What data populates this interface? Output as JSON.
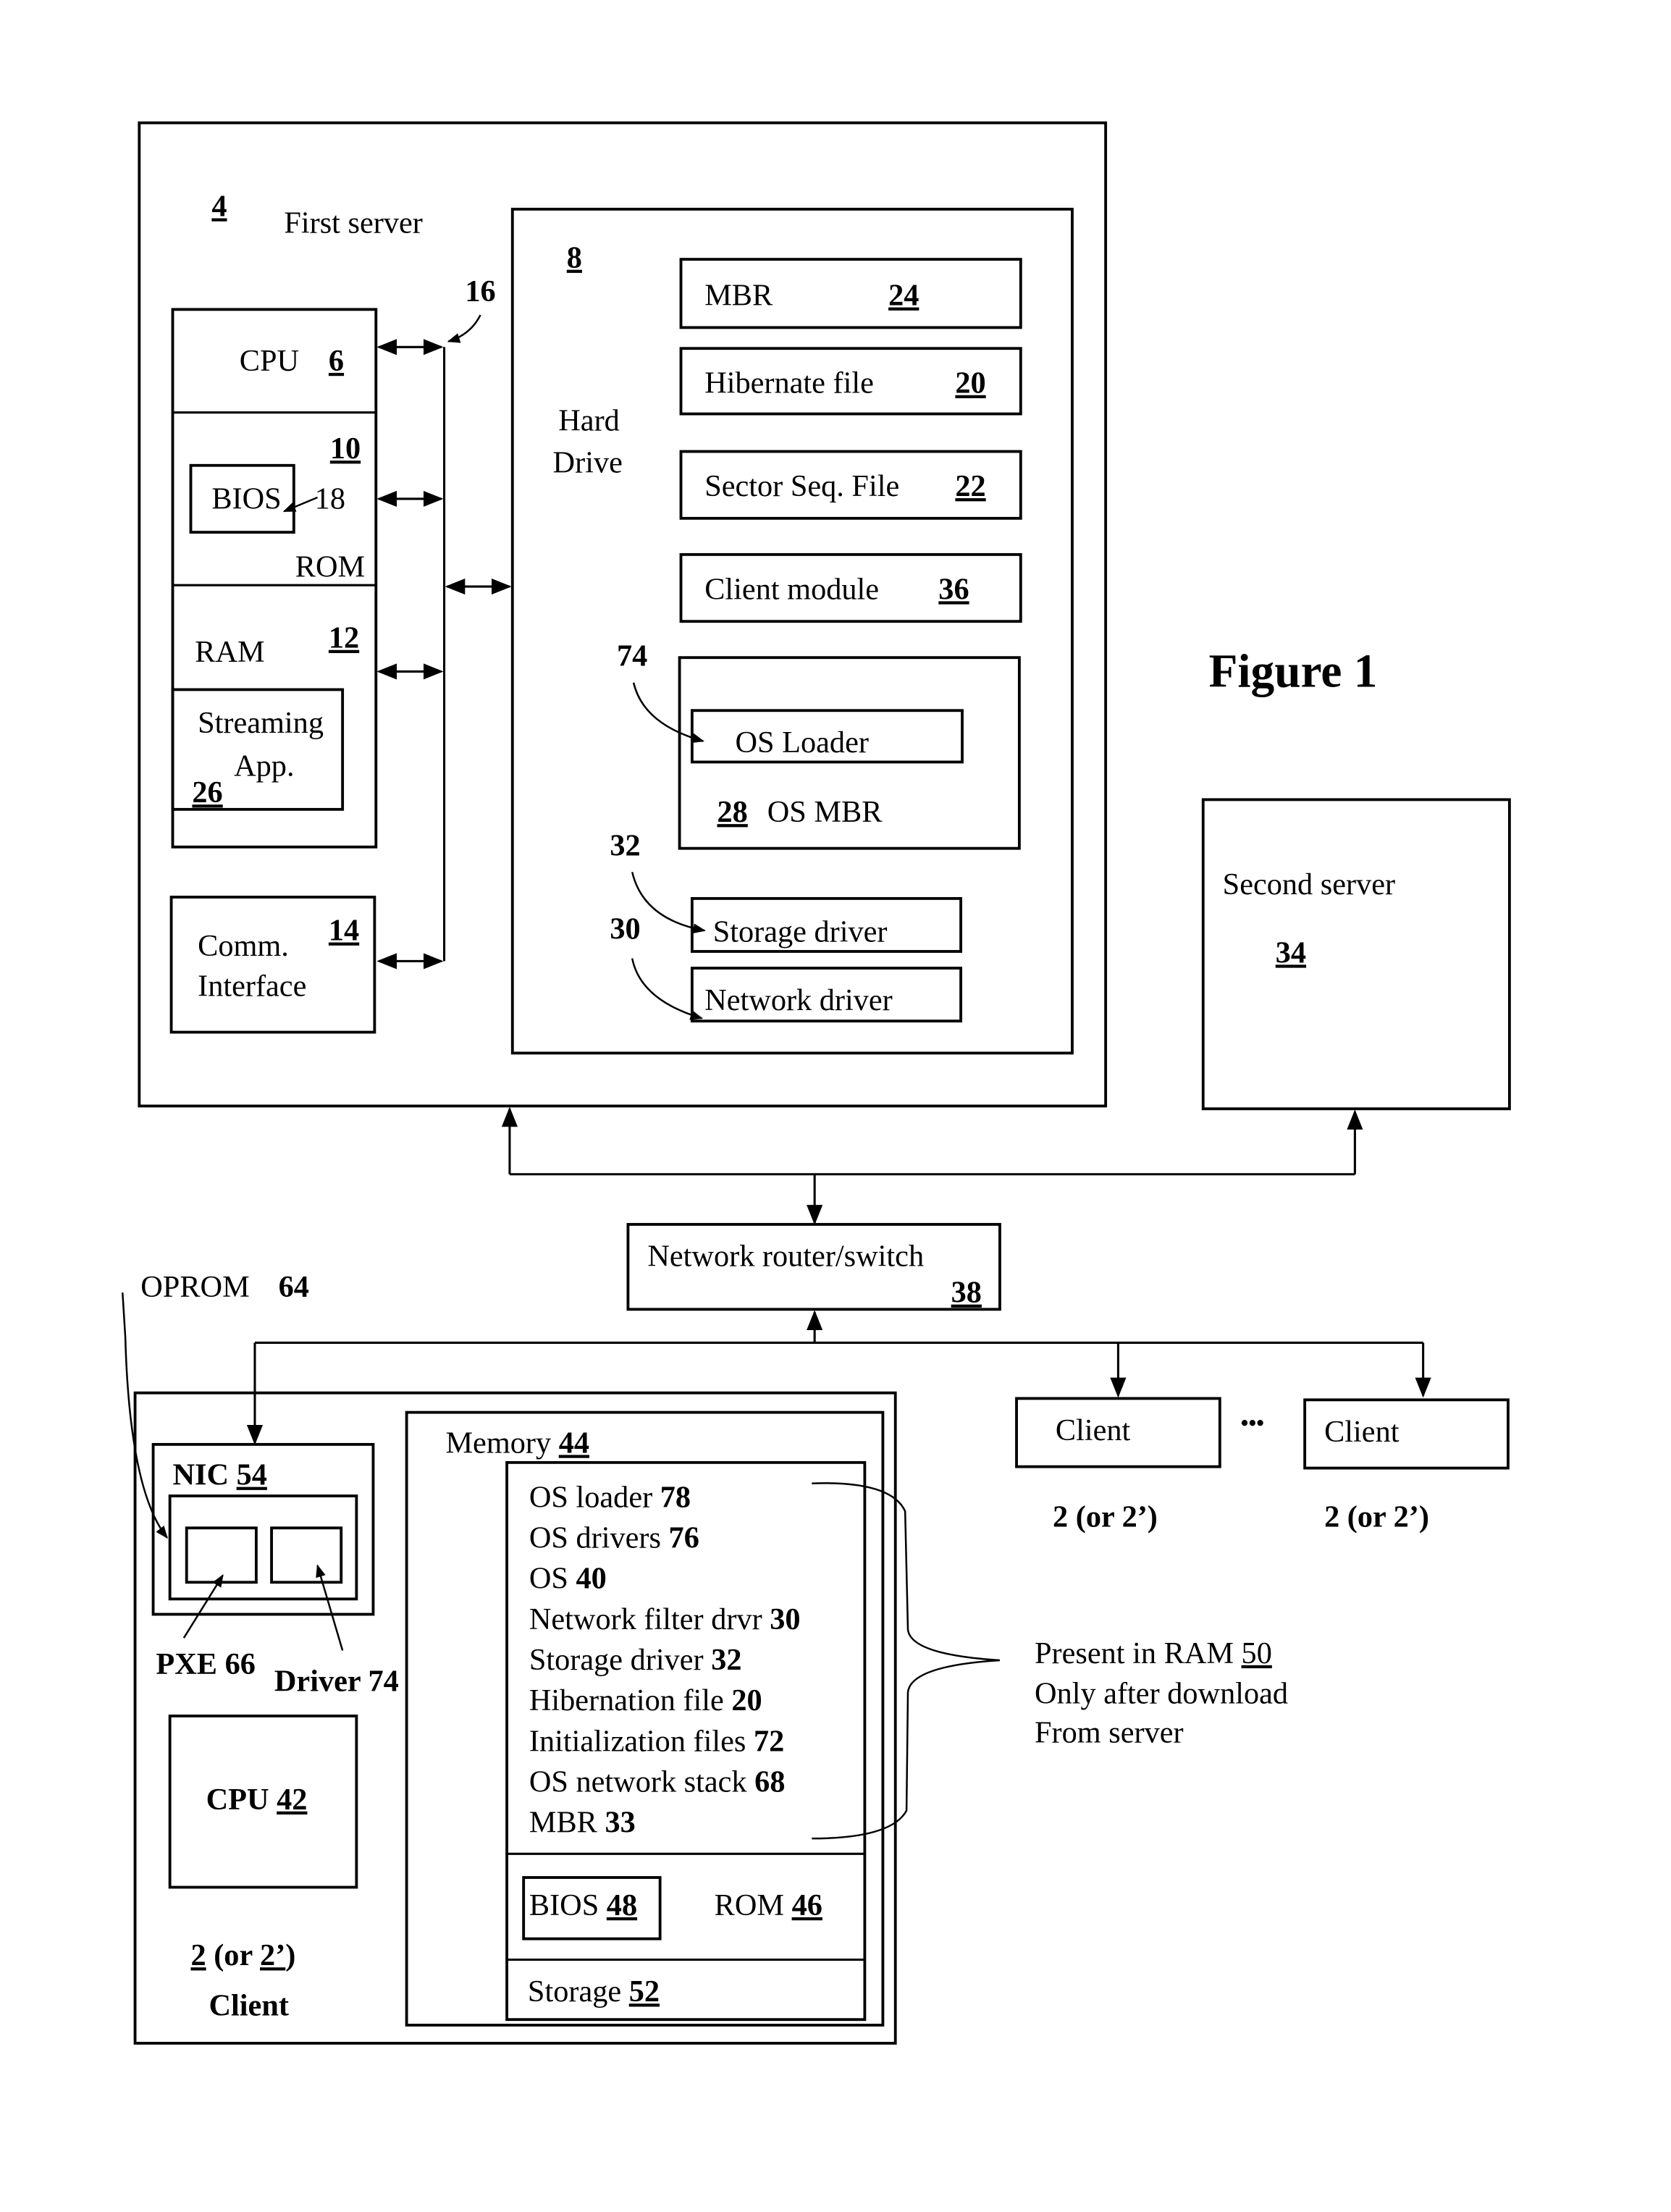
{
  "figure": {
    "title": "Figure 1"
  },
  "first_server": {
    "ref": "4",
    "label": "First server",
    "bus_ref": "16",
    "cpu": {
      "label": "CPU",
      "ref": "6"
    },
    "rom": {
      "label": "ROM",
      "ref": "10",
      "bios_label": "BIOS",
      "bios_ref": "18"
    },
    "ram": {
      "label": "RAM",
      "ref": "12",
      "app_line1": "Streaming",
      "app_line2": "App.",
      "app_ref": "26"
    },
    "comm": {
      "line1": "Comm.",
      "line2": "Interface",
      "ref": "14"
    },
    "hard_drive": {
      "ref": "8",
      "line1": "Hard",
      "line2": "Drive",
      "items": [
        {
          "label": "MBR",
          "ref": "24"
        },
        {
          "label": "Hibernate file",
          "ref": "20"
        },
        {
          "label": "Sector Seq. File",
          "ref": "22"
        },
        {
          "label": "Client module",
          "ref": "36"
        }
      ],
      "os_mbr": {
        "loader_label": "OS Loader",
        "loader_ref": "74",
        "label": "OS MBR",
        "ref": "28"
      },
      "storage_driver": {
        "label": "Storage driver",
        "ref": "32"
      },
      "network_driver": {
        "label": "Network driver",
        "ref": "30"
      }
    }
  },
  "second_server": {
    "label": "Second server",
    "ref": "34"
  },
  "router": {
    "label": "Network router/switch",
    "ref": "38"
  },
  "other_clients": {
    "client_label": "Client",
    "ellipsis": "•••",
    "ref_label": "2 (or 2’)"
  },
  "client": {
    "oprom_label": "OPROM",
    "oprom_ref": "64",
    "nic_label": "NIC",
    "nic_ref": "54",
    "pxe_label": "PXE 66",
    "driver_label": "Driver 74",
    "cpu_label": "CPU",
    "cpu_ref": "42",
    "ref_a": "2",
    "ref_mid": " (or ",
    "ref_b": "2’",
    "ref_end": ")",
    "name": "Client",
    "memory": {
      "label": "Memory",
      "ref": "44",
      "ram_items": [
        {
          "text": "OS loader",
          "ref": "78"
        },
        {
          "text": "OS drivers",
          "ref": "76"
        },
        {
          "text": "OS",
          "ref": "40"
        },
        {
          "text": "Network filter drvr",
          "ref": "30"
        },
        {
          "text": "Storage driver",
          "ref": "32"
        },
        {
          "text": "Hibernation file",
          "ref": "20"
        },
        {
          "text": "Initialization files",
          "ref": "72"
        },
        {
          "text": "OS network stack",
          "ref": "68"
        },
        {
          "text": "MBR",
          "ref": "33"
        }
      ],
      "bios_label": "BIOS",
      "bios_ref": "48",
      "rom_label": "ROM",
      "rom_ref": "46",
      "storage_label": "Storage",
      "storage_ref": "52"
    }
  },
  "annotation": {
    "line1_text": "Present in RAM ",
    "line1_ref": "50",
    "line2": "Only after download",
    "line3": "From server"
  }
}
